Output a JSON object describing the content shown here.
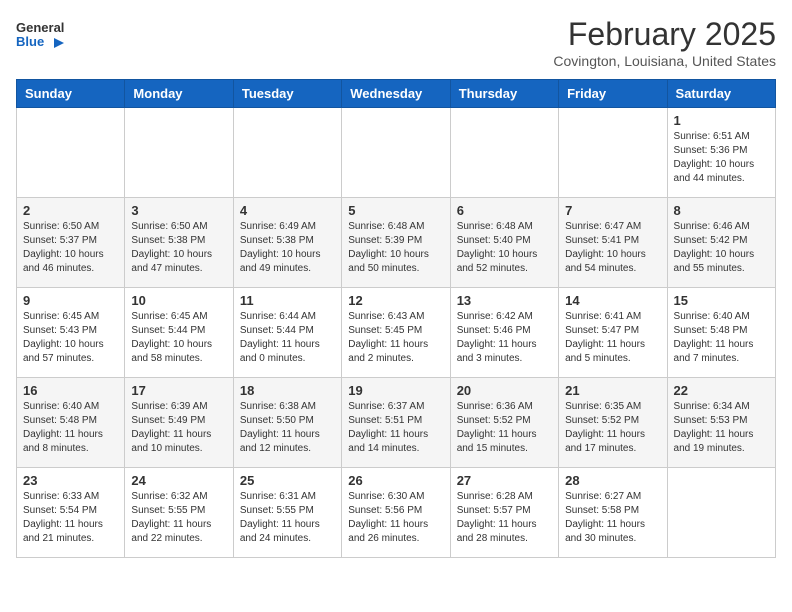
{
  "header": {
    "logo_general": "General",
    "logo_blue": "Blue",
    "month": "February 2025",
    "location": "Covington, Louisiana, United States"
  },
  "weekdays": [
    "Sunday",
    "Monday",
    "Tuesday",
    "Wednesday",
    "Thursday",
    "Friday",
    "Saturday"
  ],
  "weeks": [
    [
      {
        "day": "",
        "info": ""
      },
      {
        "day": "",
        "info": ""
      },
      {
        "day": "",
        "info": ""
      },
      {
        "day": "",
        "info": ""
      },
      {
        "day": "",
        "info": ""
      },
      {
        "day": "",
        "info": ""
      },
      {
        "day": "1",
        "info": "Sunrise: 6:51 AM\nSunset: 5:36 PM\nDaylight: 10 hours and 44 minutes."
      }
    ],
    [
      {
        "day": "2",
        "info": "Sunrise: 6:50 AM\nSunset: 5:37 PM\nDaylight: 10 hours and 46 minutes."
      },
      {
        "day": "3",
        "info": "Sunrise: 6:50 AM\nSunset: 5:38 PM\nDaylight: 10 hours and 47 minutes."
      },
      {
        "day": "4",
        "info": "Sunrise: 6:49 AM\nSunset: 5:38 PM\nDaylight: 10 hours and 49 minutes."
      },
      {
        "day": "5",
        "info": "Sunrise: 6:48 AM\nSunset: 5:39 PM\nDaylight: 10 hours and 50 minutes."
      },
      {
        "day": "6",
        "info": "Sunrise: 6:48 AM\nSunset: 5:40 PM\nDaylight: 10 hours and 52 minutes."
      },
      {
        "day": "7",
        "info": "Sunrise: 6:47 AM\nSunset: 5:41 PM\nDaylight: 10 hours and 54 minutes."
      },
      {
        "day": "8",
        "info": "Sunrise: 6:46 AM\nSunset: 5:42 PM\nDaylight: 10 hours and 55 minutes."
      }
    ],
    [
      {
        "day": "9",
        "info": "Sunrise: 6:45 AM\nSunset: 5:43 PM\nDaylight: 10 hours and 57 minutes."
      },
      {
        "day": "10",
        "info": "Sunrise: 6:45 AM\nSunset: 5:44 PM\nDaylight: 10 hours and 58 minutes."
      },
      {
        "day": "11",
        "info": "Sunrise: 6:44 AM\nSunset: 5:44 PM\nDaylight: 11 hours and 0 minutes."
      },
      {
        "day": "12",
        "info": "Sunrise: 6:43 AM\nSunset: 5:45 PM\nDaylight: 11 hours and 2 minutes."
      },
      {
        "day": "13",
        "info": "Sunrise: 6:42 AM\nSunset: 5:46 PM\nDaylight: 11 hours and 3 minutes."
      },
      {
        "day": "14",
        "info": "Sunrise: 6:41 AM\nSunset: 5:47 PM\nDaylight: 11 hours and 5 minutes."
      },
      {
        "day": "15",
        "info": "Sunrise: 6:40 AM\nSunset: 5:48 PM\nDaylight: 11 hours and 7 minutes."
      }
    ],
    [
      {
        "day": "16",
        "info": "Sunrise: 6:40 AM\nSunset: 5:48 PM\nDaylight: 11 hours and 8 minutes."
      },
      {
        "day": "17",
        "info": "Sunrise: 6:39 AM\nSunset: 5:49 PM\nDaylight: 11 hours and 10 minutes."
      },
      {
        "day": "18",
        "info": "Sunrise: 6:38 AM\nSunset: 5:50 PM\nDaylight: 11 hours and 12 minutes."
      },
      {
        "day": "19",
        "info": "Sunrise: 6:37 AM\nSunset: 5:51 PM\nDaylight: 11 hours and 14 minutes."
      },
      {
        "day": "20",
        "info": "Sunrise: 6:36 AM\nSunset: 5:52 PM\nDaylight: 11 hours and 15 minutes."
      },
      {
        "day": "21",
        "info": "Sunrise: 6:35 AM\nSunset: 5:52 PM\nDaylight: 11 hours and 17 minutes."
      },
      {
        "day": "22",
        "info": "Sunrise: 6:34 AM\nSunset: 5:53 PM\nDaylight: 11 hours and 19 minutes."
      }
    ],
    [
      {
        "day": "23",
        "info": "Sunrise: 6:33 AM\nSunset: 5:54 PM\nDaylight: 11 hours and 21 minutes."
      },
      {
        "day": "24",
        "info": "Sunrise: 6:32 AM\nSunset: 5:55 PM\nDaylight: 11 hours and 22 minutes."
      },
      {
        "day": "25",
        "info": "Sunrise: 6:31 AM\nSunset: 5:55 PM\nDaylight: 11 hours and 24 minutes."
      },
      {
        "day": "26",
        "info": "Sunrise: 6:30 AM\nSunset: 5:56 PM\nDaylight: 11 hours and 26 minutes."
      },
      {
        "day": "27",
        "info": "Sunrise: 6:28 AM\nSunset: 5:57 PM\nDaylight: 11 hours and 28 minutes."
      },
      {
        "day": "28",
        "info": "Sunrise: 6:27 AM\nSunset: 5:58 PM\nDaylight: 11 hours and 30 minutes."
      },
      {
        "day": "",
        "info": ""
      }
    ]
  ]
}
